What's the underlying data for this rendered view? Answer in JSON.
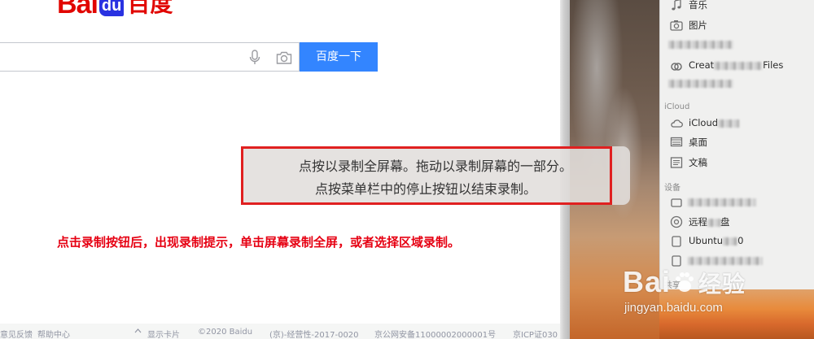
{
  "baidu": {
    "logo_text_latin": "Bai",
    "logo_text_du": "du",
    "logo_text_cn": "百度",
    "search_value": "",
    "search_button": "百度一下",
    "footer": [
      "意见反馈",
      "帮助中心",
      "显示卡片",
      "©2020 Baidu",
      "(京)-经营性-2017-0020",
      "京公网安备11000002000001号",
      "京ICP证030"
    ]
  },
  "finder": {
    "items_top": [
      {
        "icon": "music-icon",
        "label": "音乐"
      },
      {
        "icon": "camera-icon",
        "label": "图片"
      },
      {
        "icon": "folder-icon",
        "label": ""
      },
      {
        "icon": "creative-cloud-icon",
        "label": "Creat",
        "label_suffix": "Files"
      },
      {
        "icon": "folder-icon",
        "label": ""
      }
    ],
    "section_icloud": "iCloud",
    "items_icloud": [
      {
        "icon": "cloud-icon",
        "label": "iCloud"
      },
      {
        "icon": "desktop-icon",
        "label": "桌面"
      },
      {
        "icon": "document-icon",
        "label": "文稿"
      }
    ],
    "section_devices": "设备",
    "items_devices": [
      {
        "icon": "drive-icon",
        "label": ""
      },
      {
        "icon": "disc-icon",
        "label": "远程",
        "label_suffix": "盘"
      },
      {
        "icon": "drive-icon",
        "label": "Ubuntu",
        "label_suffix": "0"
      },
      {
        "icon": "drive-icon",
        "label": ""
      }
    ],
    "section_shared": "共享"
  },
  "hint": {
    "line1": "点按以录制全屏幕。拖动以录制屏幕的一部分。",
    "line2": "点按菜单栏中的停止按钮以结束录制。"
  },
  "annotation": "点击录制按钮后，出现录制提示，单击屏幕录制全屏，或者选择区域录制。",
  "watermark": {
    "main": "Bai",
    "main_suffix": "经验",
    "url": "jingyan.baidu.com"
  }
}
